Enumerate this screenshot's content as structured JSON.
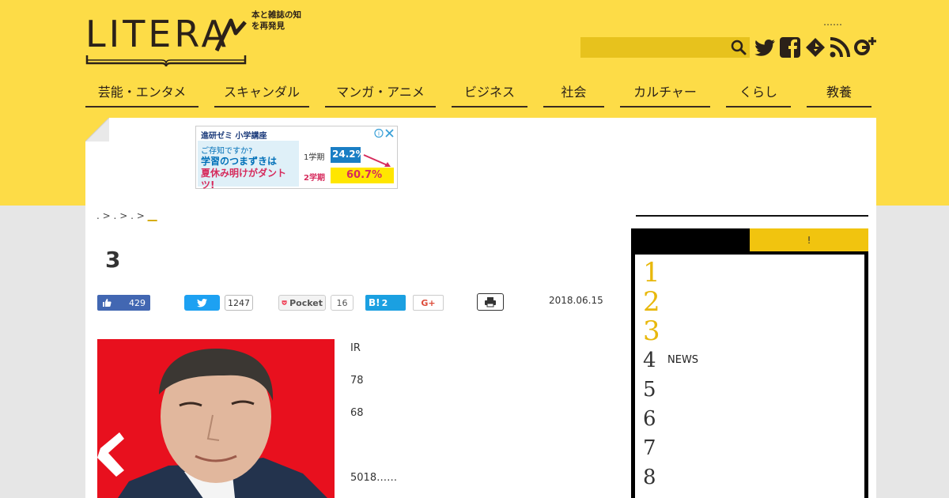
{
  "header": {
    "logo_text": "LITERA",
    "tagline": "本と雑誌の知を再発見",
    "top_dots": "……"
  },
  "nav": [
    {
      "label": "芸能・エンタメ"
    },
    {
      "label": "スキャンダル"
    },
    {
      "label": "マンガ・アニメ"
    },
    {
      "label": "ビジネス"
    },
    {
      "label": "社会"
    },
    {
      "label": "カルチャー"
    },
    {
      "label": "くらし"
    },
    {
      "label": "教養"
    }
  ],
  "ad": {
    "brand": "進研ゼミ 小学講座",
    "line1": "ご存知ですか?",
    "line2": "学習のつまずきは",
    "line3": "夏休み明けがダントツ!",
    "term1": "1学期",
    "value1": "24.2%",
    "term2": "2学期",
    "value2": "60.7%"
  },
  "breadcrumb": {
    "segments": [
      ".",
      ">",
      ".",
      ">",
      ".",
      ">"
    ],
    "current": "__"
  },
  "article": {
    "title": "3",
    "date": "2018.06.15",
    "paragraphs": [
      "IR",
      "78",
      "68",
      "5018……"
    ]
  },
  "share": {
    "facebook_count": "429",
    "twitter_count": "1247",
    "pocket_label": "Pocket",
    "pocket_count": "16",
    "hatena_count": "2",
    "gplus_label": "G+"
  },
  "sidebar": {
    "tab_right": "!",
    "ranking": [
      {
        "rank": "1",
        "label": ""
      },
      {
        "rank": "2",
        "label": ""
      },
      {
        "rank": "3",
        "label": ""
      },
      {
        "rank": "4",
        "label": "NEWS"
      },
      {
        "rank": "5",
        "label": ""
      },
      {
        "rank": "6",
        "label": ""
      },
      {
        "rank": "7",
        "label": ""
      },
      {
        "rank": "8",
        "label": ""
      }
    ]
  },
  "colors": {
    "brand_yellow": "#fddc47",
    "accent_gold": "#e8b80c",
    "text_dark": "#2b2119"
  }
}
